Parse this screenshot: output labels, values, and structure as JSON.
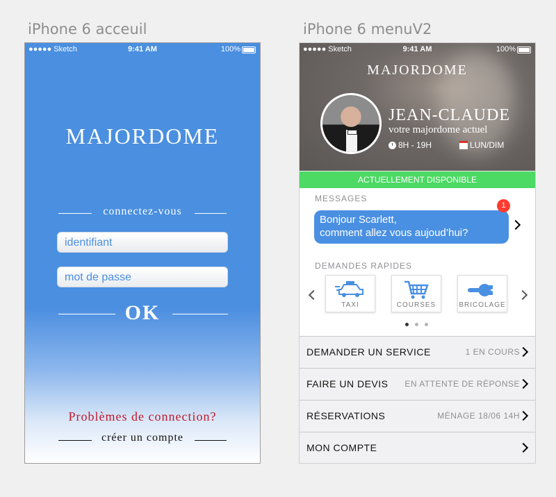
{
  "artboards": {
    "left_title": "iPhone 6 acceuil",
    "right_title": "iPhone 6 menuV2"
  },
  "status_bar": {
    "carrier": "●●●●● Sketch",
    "time": "9:41 AM",
    "battery": "100%"
  },
  "login": {
    "brand": "MAJORDOME",
    "connect_label": "connectez-vous",
    "username_placeholder": "identifiant",
    "password_placeholder": "mot de passe",
    "ok_button": "OK",
    "problem_link": "Problèmes de connection?",
    "create_account_link": "créer un compte",
    "colors": {
      "background": "#4a8fe0",
      "problem_text": "#c1162a"
    }
  },
  "menu": {
    "brand": "MAJORDOME",
    "butler": {
      "name": "JEAN-CLAUDE",
      "subtitle": "votre majordome actuel",
      "hours": "8H - 19H",
      "days": "LUN/DIM"
    },
    "availability": "ACTUELLEMENT DISPONIBLE",
    "messages": {
      "label": "MESSAGES",
      "badge_count": "1",
      "text_line1": "Bonjour Scarlett,",
      "text_line2": "comment allez vous aujoud’hui?"
    },
    "quick_requests": {
      "label": "DEMANDES RAPIDES",
      "items": [
        {
          "label": "TAXI",
          "icon": "taxi-icon"
        },
        {
          "label": "COURSES",
          "icon": "shopping-cart-icon"
        },
        {
          "label": "BRICOLAGE",
          "icon": "wrench-icon"
        }
      ],
      "page_indicator": {
        "pages": 3,
        "active": 1
      }
    },
    "rows": [
      {
        "title": "DEMANDER UN SERVICE",
        "detail": "1 EN COURS"
      },
      {
        "title": "FAIRE UN DEVIS",
        "detail": "EN ATTENTE DE RÉPONSE"
      },
      {
        "title": "RÉSERVATIONS",
        "detail": "MÉNAGE 18/06 14H"
      },
      {
        "title": "MON COMPTE",
        "detail": ""
      }
    ],
    "colors": {
      "accent": "#4a90e2",
      "available": "#4cd964",
      "badge": "#ff3b30"
    }
  }
}
